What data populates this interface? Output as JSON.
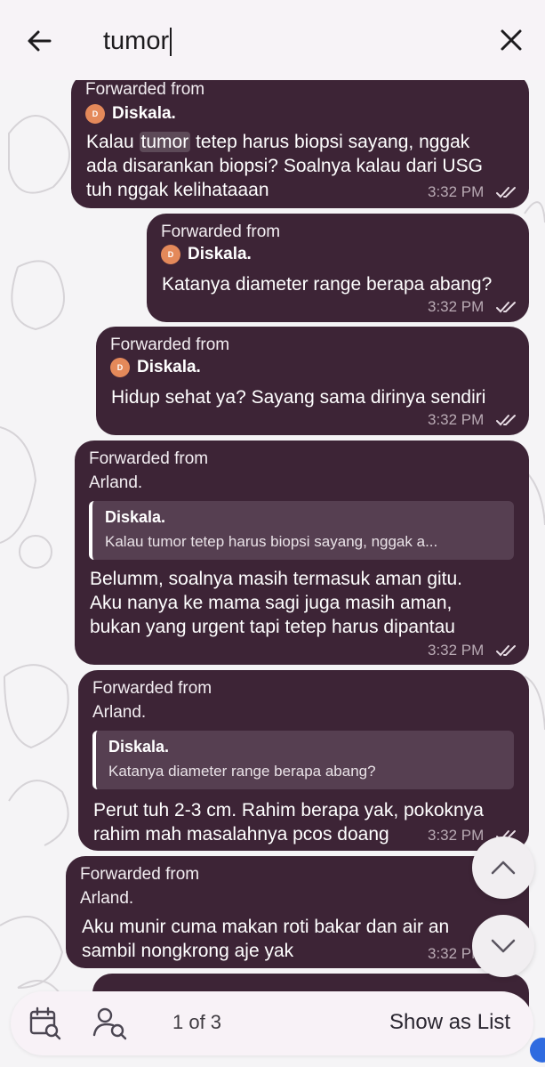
{
  "search": {
    "query": "tumor"
  },
  "messages": [
    {
      "forwarded_label": "Forwarded from",
      "sender": "Diskala.",
      "avatar_letter": "D",
      "text_before": "Kalau ",
      "highlight": "tumor",
      "text_after": " tetep harus biopsi sayang, nggak\nada disarankan biopsi? Soalnya kalau dari USG\ntuh nggak kelihataaan",
      "time": "3:32 PM"
    },
    {
      "forwarded_label": "Forwarded from",
      "sender": "Diskala.",
      "avatar_letter": "D",
      "text": "Katanya diameter range berapa abang?",
      "time": "3:32 PM"
    },
    {
      "forwarded_label": "Forwarded from",
      "sender": "Diskala.",
      "avatar_letter": "D",
      "text": "Hidup sehat ya? Sayang sama dirinya sendiri",
      "time": "3:32 PM"
    },
    {
      "forwarded_label": "Forwarded from",
      "sender": "Arland.",
      "quote_name": "Diskala.",
      "quote_text": "Kalau tumor tetep harus biopsi sayang, nggak a...",
      "text": "Belumm, soalnya masih termasuk aman gitu.\nAku nanya ke mama sagi juga masih aman,\nbukan yang urgent tapi tetep harus dipantau",
      "time": "3:32 PM"
    },
    {
      "forwarded_label": "Forwarded from",
      "sender": "Arland.",
      "quote_name": "Diskala.",
      "quote_text": "Katanya diameter range berapa abang?",
      "text": "Perut tuh 2-3 cm. Rahim berapa yak, pokoknya\nrahim mah masalahnya pcos doang",
      "time": "3:32 PM"
    },
    {
      "forwarded_label": "Forwarded from",
      "sender": "Arland.",
      "text": "Aku munir cuma makan roti bakar dan air an\nsambil nongkrong aje yak",
      "time": "3:32 PM"
    }
  ],
  "bottom_bar": {
    "counter": "1 of 3",
    "show_list_label": "Show as List"
  },
  "colors": {
    "bubble": "#3d2436",
    "avatar": "#e4895a",
    "quote_bg": "#563f51"
  },
  "icons": [
    "back-arrow-icon",
    "close-icon",
    "calendar-search-icon",
    "user-search-icon",
    "chevron-up-icon",
    "chevron-down-icon",
    "double-check-icon"
  ]
}
